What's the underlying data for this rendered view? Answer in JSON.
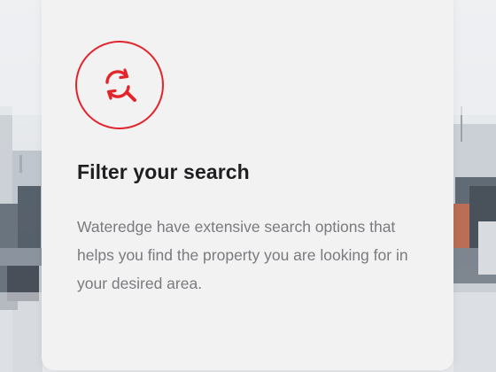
{
  "feature_card": {
    "icon": "search-refresh-icon",
    "title": "Filter your search",
    "description": "Wateredge have extensive search options that helps you find the property you are looking for in your desired area."
  },
  "colors": {
    "accent": "#e3242b",
    "title": "#1f1f22",
    "body_text": "#7a7a7f",
    "card_background": "#f2f2f3"
  }
}
